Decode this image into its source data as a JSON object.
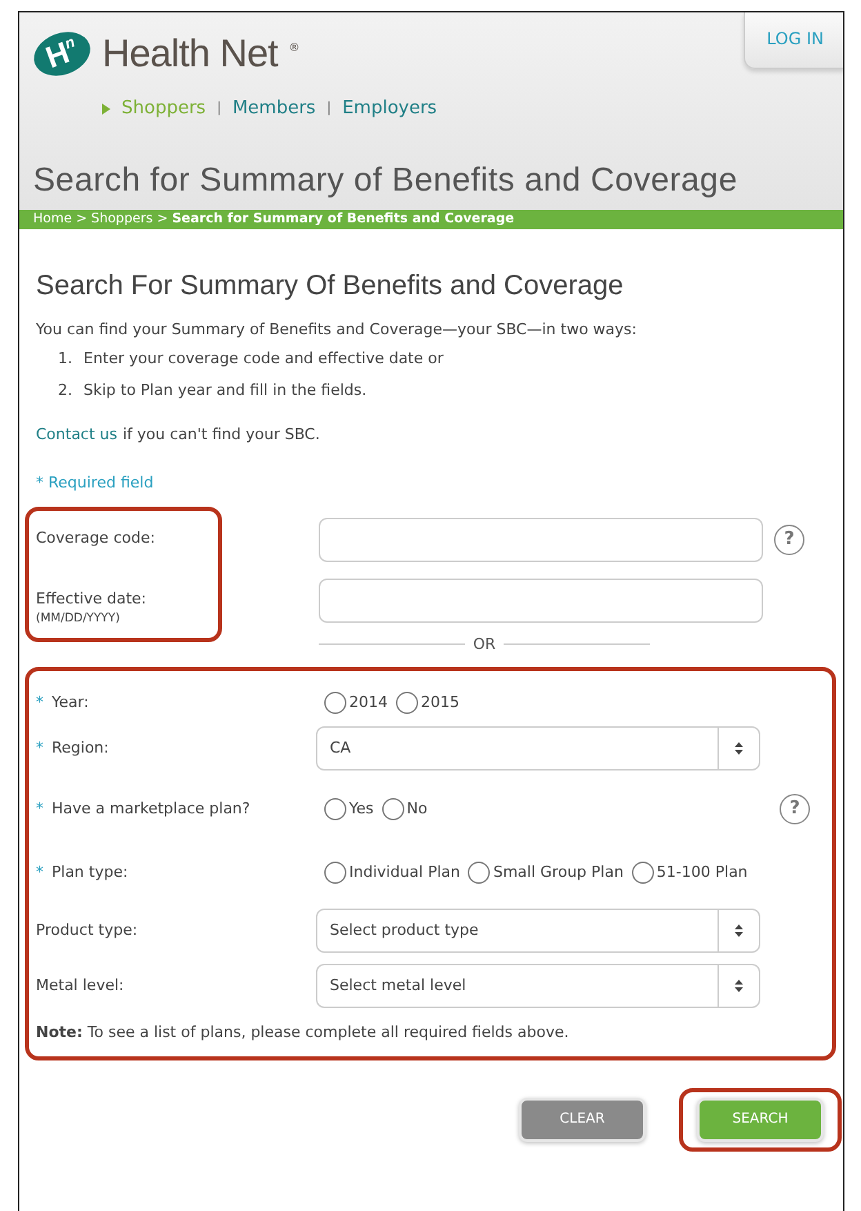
{
  "logo": {
    "mark": "H$^{n}$",
    "name": "Health Net",
    "trademark": "®"
  },
  "login": {
    "label": "LOG IN"
  },
  "audience_nav": [
    {
      "label": "Shoppers",
      "selected": true
    },
    {
      "label": "Members",
      "selected": false
    },
    {
      "label": "Employers",
      "selected": false
    }
  ],
  "nav_separator": "|",
  "page_title": "Search for Summary of Benefits and Coverage",
  "breadcrumb": "Home > Shoppers > **Search for Summary of Benefits and Coverage**",
  "form_title": "Search For Summary Of Benefits and Coverage",
  "intro": "You can find your Summary of Benefits and Coverage—your SBC—in two ways:",
  "steps": [
    {
      "number": "1.",
      "text": "Enter your coverage code and effective date or"
    },
    {
      "number": "2.",
      "text": "Skip to Plan year and fill in the fields."
    }
  ],
  "contact": {
    "link": "Contact us",
    "text": "if you can't find your SBC."
  },
  "required_note": "* Required field",
  "required_mark": "*",
  "code_group": {
    "highlighted": true,
    "fields": [
      {
        "label": "Coverage code:",
        "help": "?"
      },
      {
        "label": "Effective date:",
        "hint": "(MM/DD/YYYY)"
      }
    ]
  },
  "divider": "OR",
  "plan_group": {
    "highlighted": true,
    "rows": [
      {
        "kind": "radio",
        "label": "Year:",
        "required": true,
        "options": [
          {
            "label": "2014",
            "selected": false
          },
          {
            "label": "2015",
            "selected": false
          }
        ]
      },
      {
        "kind": "select",
        "label": "Region:",
        "required": true,
        "value": "CA"
      },
      {
        "kind": "radio",
        "label": "Have a marketplace plan?",
        "required": true,
        "help": "?",
        "options": [
          {
            "label": "Yes",
            "selected": false
          },
          {
            "label": "No",
            "selected": false
          }
        ]
      },
      {
        "kind": "radio",
        "label": "Plan type:",
        "required": true,
        "options": [
          {
            "label": "Individual Plan",
            "selected": false
          },
          {
            "label": "Small Group Plan",
            "selected": false
          },
          {
            "label": "51-100 Plan",
            "selected": false
          }
        ]
      },
      {
        "kind": "select",
        "label": "Product type:",
        "required": false,
        "value": "Select product type"
      },
      {
        "kind": "select",
        "label": "Metal level:",
        "required": false,
        "value": "Select metal level"
      }
    ],
    "note": "**Note:** To see a list of plans, please complete all required fields above."
  },
  "buttons": [
    {
      "label": "CLEAR",
      "kind": "secondary",
      "highlighted": false
    },
    {
      "label": "SEARCH",
      "kind": "primary",
      "highlighted": true
    }
  ]
}
